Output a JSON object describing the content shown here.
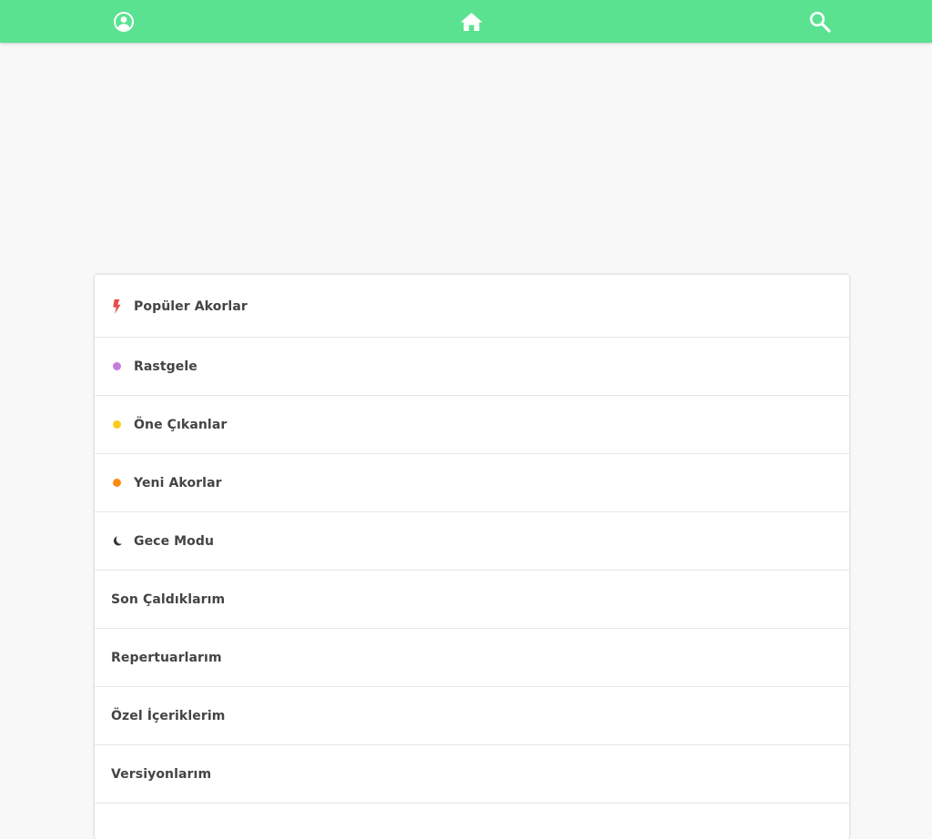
{
  "colors": {
    "topbar": "#5ae291",
    "lightning": "#e84c4c",
    "random": "#c77ddb",
    "featured": "#fdcb1e",
    "new": "#fd8a10",
    "night": "#333333"
  },
  "header": {
    "profile_icon": "user-circle-icon",
    "home_icon": "home-icon",
    "search_icon": "search-icon"
  },
  "menu": {
    "items": [
      {
        "label": "Popüler Akorlar",
        "icon": "lightning-icon"
      },
      {
        "label": "Rastgele",
        "icon": "purple-dot-icon"
      },
      {
        "label": "Öne Çıkanlar",
        "icon": "yellow-dot-icon"
      },
      {
        "label": "Yeni Akorlar",
        "icon": "orange-dot-icon"
      },
      {
        "label": "Gece Modu",
        "icon": "moon-icon"
      },
      {
        "label": "Son Çaldıklarım"
      },
      {
        "label": "Repertuarlarım"
      },
      {
        "label": "Özel İçeriklerim"
      },
      {
        "label": "Versiyonlarım"
      }
    ]
  }
}
